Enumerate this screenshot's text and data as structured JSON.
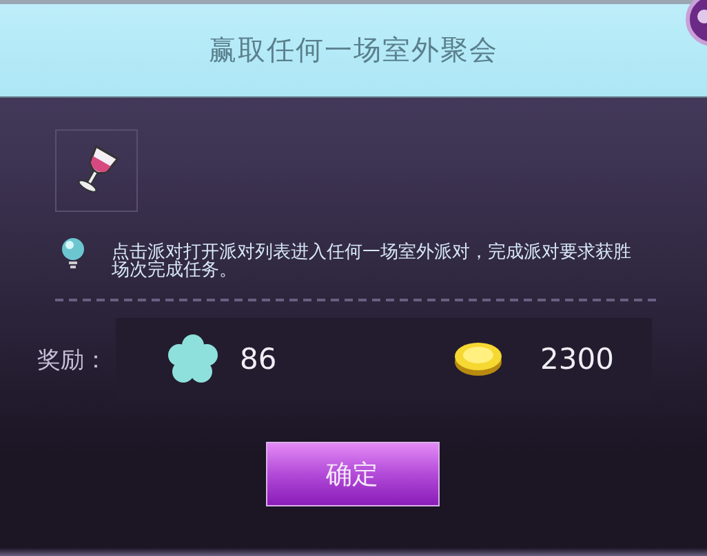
{
  "dialog": {
    "title": "赢取任何一场室外聚会"
  },
  "hint": "点击派对打开派对列表进入任何一场室外派对，完成派对要求获胜场次完成任务。",
  "rewards": {
    "label": "奖励：",
    "items": [
      {
        "kind": "gem",
        "amount": "86"
      },
      {
        "kind": "coin",
        "amount": "2300"
      }
    ]
  },
  "confirm_button": "确定"
}
